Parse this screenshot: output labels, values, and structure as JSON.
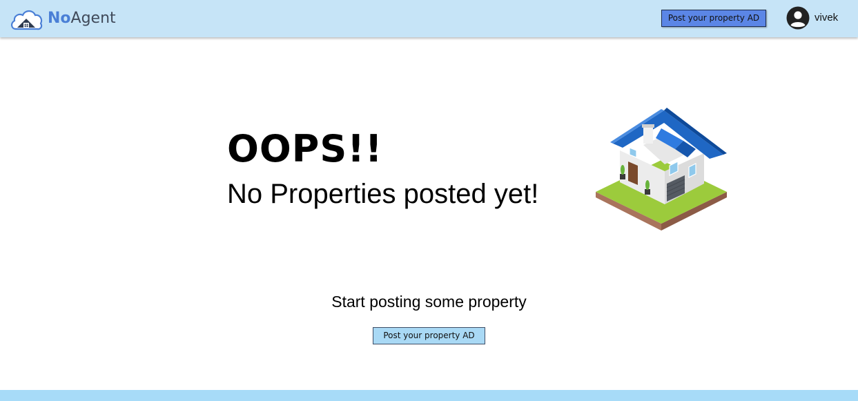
{
  "header": {
    "logo": {
      "part_bold": "No",
      "part_light": "Agent",
      "icon": "cloud-house-icon"
    },
    "post_ad_button": "Post your property AD",
    "user": {
      "avatar_icon": "account-circle-icon",
      "name": "vivek"
    }
  },
  "main": {
    "heading": "OOPS!!",
    "message": "No Properties posted yet!",
    "illustration": "house-illustration",
    "cta_text": "Start posting some property",
    "cta_button": "Post your property AD"
  },
  "colors": {
    "header_bg": "#c6e4f7",
    "top_button_bg": "#5b86e6",
    "cta_button_bg": "#a9d9f5",
    "footer_bg": "#a7dbf8",
    "brand_blue": "#4a7fd6"
  }
}
